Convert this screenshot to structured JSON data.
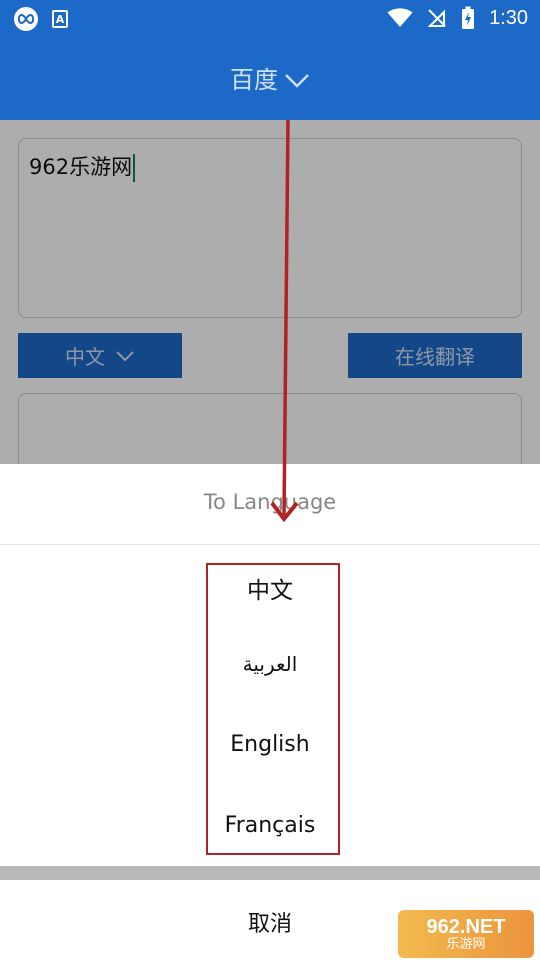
{
  "status_bar": {
    "time": "1:30",
    "icons": [
      "infinity-icon",
      "font-a-icon",
      "wifi-icon",
      "no-signal-icon",
      "battery-charging-icon"
    ]
  },
  "app_bar": {
    "title": "百度",
    "title_icon": "chevron-down-icon"
  },
  "editor": {
    "input_text": "962乐游网",
    "output_text": ""
  },
  "controls": {
    "language_button": "中文",
    "translate_button": "在线翻译"
  },
  "sheet": {
    "title": "To Language",
    "options": [
      "中文",
      "العربية",
      "English",
      "Français"
    ],
    "cancel_label": "取消"
  },
  "watermark": {
    "top": "962.NET",
    "bottom": "乐游网"
  },
  "colors": {
    "primary": "#1c69c7",
    "annotation": "#b22222",
    "overlay": "rgba(0,0,0,0.32)"
  }
}
